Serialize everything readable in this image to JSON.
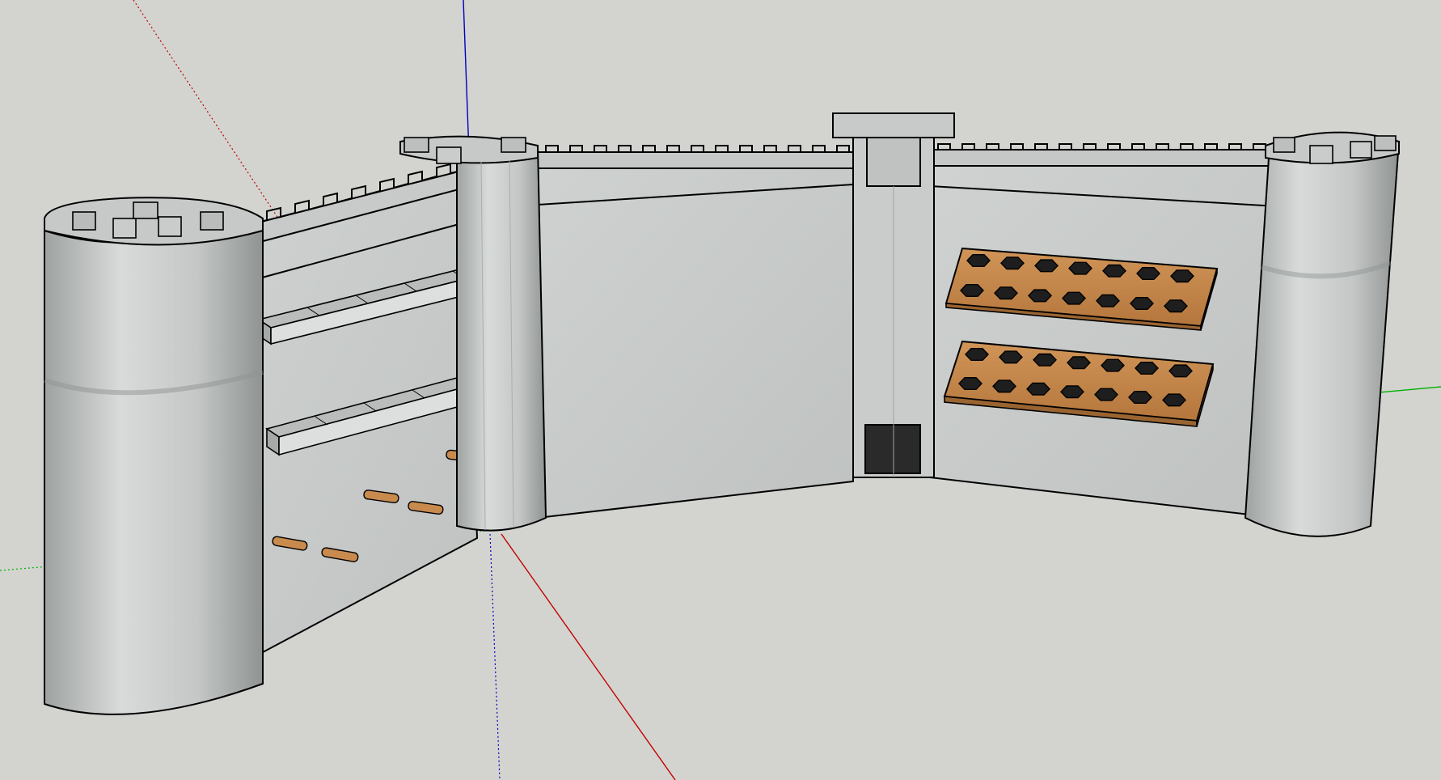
{
  "viewport": {
    "background": "#d3d4d0",
    "axis_colors": {
      "red": "#c40000",
      "green": "#00b000",
      "blue": "#0000c0"
    }
  },
  "model": {
    "stone_color": "#c6c9c8",
    "stone_light": "#d6d9d8",
    "stone_dark": "#a9adac",
    "edge_color": "#000000",
    "wood_color": "#c98a4e",
    "wood_dark": "#9a6431",
    "hole_color": "#1e1e1e",
    "door_color": "#2a2a2a"
  },
  "icons": {
    "x_axis": "red-axis-icon",
    "y_axis": "green-axis-icon",
    "z_axis": "blue-axis-icon"
  }
}
